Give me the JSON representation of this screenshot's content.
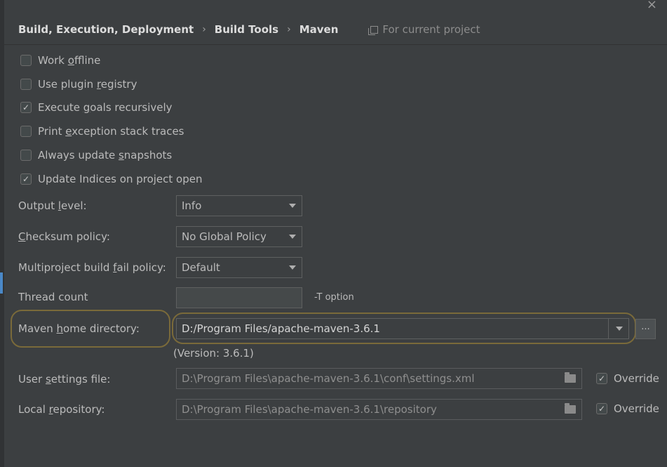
{
  "breadcrumb": {
    "items": [
      "Build, Execution, Deployment",
      "Build Tools",
      "Maven"
    ],
    "scope": "For current project"
  },
  "checkboxes": [
    {
      "pre": "Work ",
      "mn": "o",
      "post": "ffline",
      "checked": false
    },
    {
      "pre": "Use plugin ",
      "mn": "r",
      "post": "egistry",
      "checked": false
    },
    {
      "pre": "Execute ",
      "mn": "g",
      "post": "oals recursively",
      "checked": true
    },
    {
      "pre": "Print ",
      "mn": "e",
      "post": "xception stack traces",
      "checked": false
    },
    {
      "pre": "Always update ",
      "mn": "s",
      "post": "napshots",
      "checked": false
    },
    {
      "pre": "Update Indices on project open",
      "mn": "",
      "post": "",
      "checked": true
    }
  ],
  "output_level": {
    "pre": "Output ",
    "mn": "l",
    "post": "evel:",
    "value": "Info"
  },
  "checksum_policy": {
    "pre": "",
    "mn": "C",
    "post": "hecksum policy:",
    "value": "No Global Policy"
  },
  "fail_policy": {
    "pre": "Multiproject build ",
    "mn": "f",
    "post": "ail policy:",
    "value": "Default"
  },
  "thread_count": {
    "label": "Thread count",
    "value": "",
    "hint": "-T option"
  },
  "maven_home": {
    "pre": "Maven ",
    "mn": "h",
    "post": "ome directory:",
    "value": "D:/Program Files/apache-maven-3.6.1",
    "browse": "...",
    "version": "(Version: 3.6.1)"
  },
  "user_settings": {
    "pre": "User ",
    "mn": "s",
    "post": "ettings file:",
    "value": "D:\\Program Files\\apache-maven-3.6.1\\conf\\settings.xml",
    "override": "Override",
    "override_checked": true
  },
  "local_repo": {
    "pre": "Local ",
    "mn": "r",
    "post": "epository:",
    "value": "D:\\Program Files\\apache-maven-3.6.1\\repository",
    "override": "Override",
    "override_checked": true
  },
  "icons": {
    "close": "×",
    "check": "✓"
  },
  "colors": {
    "background": "#3c3f41",
    "highlight": "#7a6a3a",
    "accent": "#4a88c7"
  }
}
